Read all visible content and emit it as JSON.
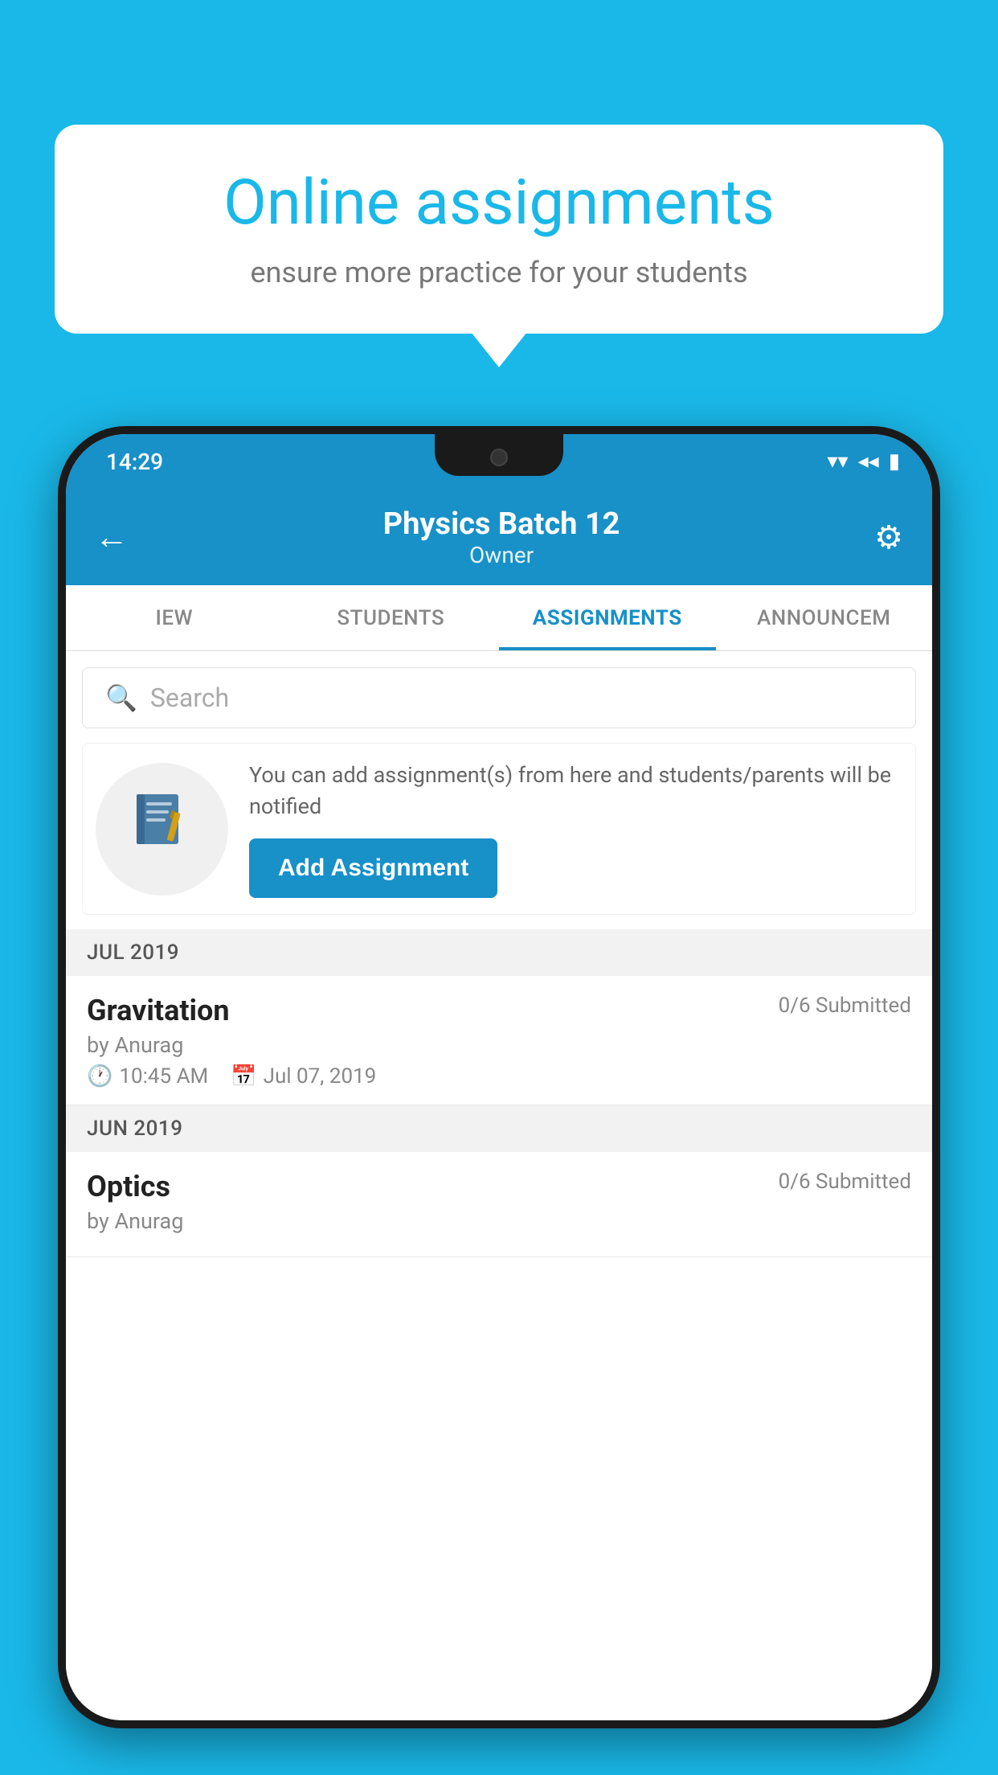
{
  "background_color": "#1ab8e8",
  "speech_bubble": {
    "title": "Online assignments",
    "subtitle": "ensure more practice for your students"
  },
  "status_bar": {
    "time": "14:29",
    "wifi_symbol": "▼",
    "signal_symbol": "◀",
    "battery_symbol": "▮"
  },
  "header": {
    "title": "Physics Batch 12",
    "subtitle": "Owner",
    "back_icon": "←",
    "settings_icon": "⚙"
  },
  "tabs": [
    {
      "label": "IEW",
      "active": false
    },
    {
      "label": "STUDENTS",
      "active": false
    },
    {
      "label": "ASSIGNMENTS",
      "active": true
    },
    {
      "label": "ANNOUNCEM",
      "active": false
    }
  ],
  "search": {
    "placeholder": "Search",
    "icon": "🔍"
  },
  "empty_state": {
    "description": "You can add assignment(s) from here and students/parents will be notified",
    "button_label": "Add Assignment"
  },
  "sections": [
    {
      "header": "JUL 2019",
      "assignments": [
        {
          "title": "Gravitation",
          "submitted": "0/6 Submitted",
          "by": "by Anurag",
          "time": "10:45 AM",
          "date": "Jul 07, 2019"
        }
      ]
    },
    {
      "header": "JUN 2019",
      "assignments": [
        {
          "title": "Optics",
          "submitted": "0/6 Submitted",
          "by": "by Anurag",
          "time": "",
          "date": ""
        }
      ]
    }
  ]
}
